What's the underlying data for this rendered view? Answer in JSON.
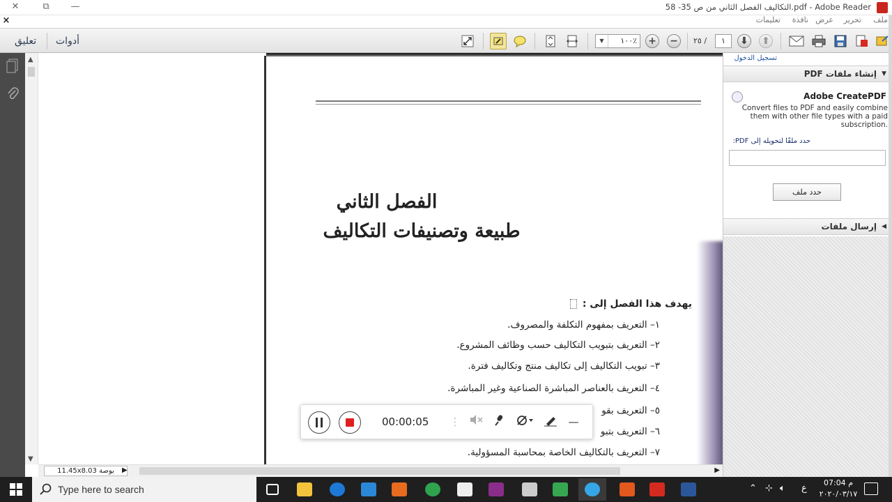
{
  "window": {
    "title": "التكاليف الفصل الثاني  من ص 35- 58.pdf - Adobe Reader",
    "controls": {
      "close": "✕",
      "restore": "⧉",
      "minimize": "—"
    }
  },
  "menubar": {
    "items": [
      "ملف",
      "تحرير",
      "عرض",
      "نافذة",
      "تعليمات"
    ],
    "close_glyph": "×"
  },
  "toolbar": {
    "comment_link": "تعليق",
    "tools_link": "أدوات",
    "page_current": "١",
    "page_total": "٢٥",
    "page_sep": "/",
    "zoom_value": "١٠٠٪",
    "zoom_in": "+",
    "zoom_out": "−"
  },
  "document": {
    "chapter_title": "الفصل الثاني",
    "chapter_subtitle": "طبيعة وتصنيفات التكاليف",
    "objectives_heading": "يهدف هذا الفصل إلى :",
    "objectives": [
      "١– التعريف بمفهوم التكلفة والمصروف.",
      "٢– التعريف بتبويب التكاليف حسب وظائف المشروع.",
      "٣– تبويب التكاليف إلى تكاليف منتج وتكاليف فترة.",
      "٤– التعريف بالعناصر المباشرة الصناعية وغير المباشرة.",
      "٥– التعريف بقو",
      "٦– التعريف بتبو",
      "٧– التعريف بالتكاليف الخاصة بمحاسبة المسؤولية."
    ]
  },
  "status": {
    "page_size": "11.45x8.03 بوصة"
  },
  "right_panel": {
    "sign_in": "تسجيل الدخول",
    "create_section": "إنشاء ملفات PDF",
    "product_name": "Adobe CreatePDF",
    "description": "Convert files to PDF and easily combine them with other file types with a paid subscription.",
    "select_label": "حدد ملفًا لتحويله إلى PDF:",
    "choose_button": "حدد ملف",
    "send_section": "إرسال ملفات"
  },
  "recorder": {
    "time": "00:00:05"
  },
  "taskbar": {
    "search_placeholder": "Type here to search",
    "clock_time": "07:04 م",
    "clock_date": "٢٠٢٠/٠٣/١٧",
    "lang": "ع",
    "apps": [
      {
        "name": "task-view",
        "color": "#ffffff"
      },
      {
        "name": "file-explorer",
        "color": "#f3c33b"
      },
      {
        "name": "edge",
        "color": "#1e78d6"
      },
      {
        "name": "store",
        "color": "#2b88d8"
      },
      {
        "name": "media-player",
        "color": "#e86c1f"
      },
      {
        "name": "chrome",
        "color": "#2ea44f"
      },
      {
        "name": "app-white",
        "color": "#eeeeee"
      },
      {
        "name": "app-french",
        "color": "#8b2d8b"
      },
      {
        "name": "app-car",
        "color": "#cccccc"
      },
      {
        "name": "app-color",
        "color": "#36a852"
      },
      {
        "name": "recorder-app",
        "color": "#35a7e8"
      },
      {
        "name": "app-orange",
        "color": "#e3581c"
      },
      {
        "name": "acrobat",
        "color": "#d42a1f"
      },
      {
        "name": "word",
        "color": "#2b579a"
      }
    ]
  }
}
